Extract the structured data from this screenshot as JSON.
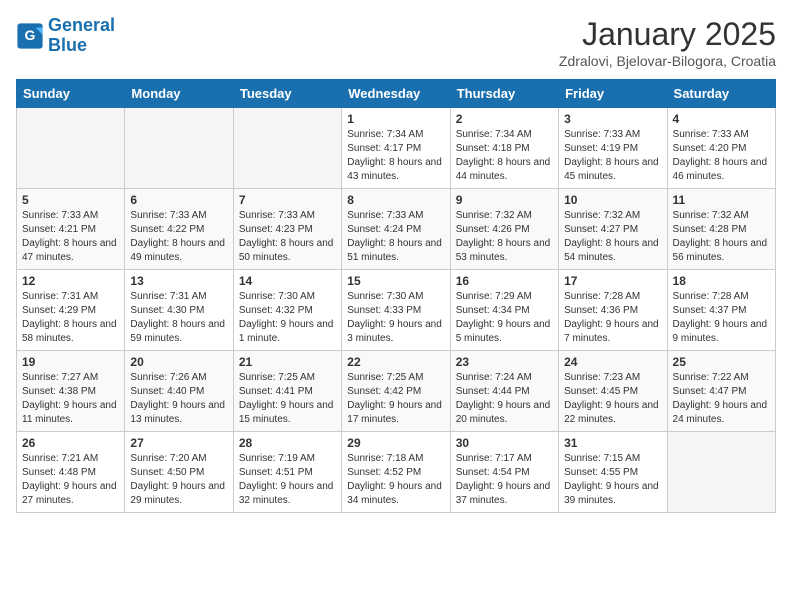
{
  "logo": {
    "line1": "General",
    "line2": "Blue"
  },
  "title": "January 2025",
  "subtitle": "Zdralovi, Bjelovar-Bilogora, Croatia",
  "weekdays": [
    "Sunday",
    "Monday",
    "Tuesday",
    "Wednesday",
    "Thursday",
    "Friday",
    "Saturday"
  ],
  "weeks": [
    [
      {
        "day": "",
        "info": ""
      },
      {
        "day": "",
        "info": ""
      },
      {
        "day": "",
        "info": ""
      },
      {
        "day": "1",
        "info": "Sunrise: 7:34 AM\nSunset: 4:17 PM\nDaylight: 8 hours and 43 minutes."
      },
      {
        "day": "2",
        "info": "Sunrise: 7:34 AM\nSunset: 4:18 PM\nDaylight: 8 hours and 44 minutes."
      },
      {
        "day": "3",
        "info": "Sunrise: 7:33 AM\nSunset: 4:19 PM\nDaylight: 8 hours and 45 minutes."
      },
      {
        "day": "4",
        "info": "Sunrise: 7:33 AM\nSunset: 4:20 PM\nDaylight: 8 hours and 46 minutes."
      }
    ],
    [
      {
        "day": "5",
        "info": "Sunrise: 7:33 AM\nSunset: 4:21 PM\nDaylight: 8 hours and 47 minutes."
      },
      {
        "day": "6",
        "info": "Sunrise: 7:33 AM\nSunset: 4:22 PM\nDaylight: 8 hours and 49 minutes."
      },
      {
        "day": "7",
        "info": "Sunrise: 7:33 AM\nSunset: 4:23 PM\nDaylight: 8 hours and 50 minutes."
      },
      {
        "day": "8",
        "info": "Sunrise: 7:33 AM\nSunset: 4:24 PM\nDaylight: 8 hours and 51 minutes."
      },
      {
        "day": "9",
        "info": "Sunrise: 7:32 AM\nSunset: 4:26 PM\nDaylight: 8 hours and 53 minutes."
      },
      {
        "day": "10",
        "info": "Sunrise: 7:32 AM\nSunset: 4:27 PM\nDaylight: 8 hours and 54 minutes."
      },
      {
        "day": "11",
        "info": "Sunrise: 7:32 AM\nSunset: 4:28 PM\nDaylight: 8 hours and 56 minutes."
      }
    ],
    [
      {
        "day": "12",
        "info": "Sunrise: 7:31 AM\nSunset: 4:29 PM\nDaylight: 8 hours and 58 minutes."
      },
      {
        "day": "13",
        "info": "Sunrise: 7:31 AM\nSunset: 4:30 PM\nDaylight: 8 hours and 59 minutes."
      },
      {
        "day": "14",
        "info": "Sunrise: 7:30 AM\nSunset: 4:32 PM\nDaylight: 9 hours and 1 minute."
      },
      {
        "day": "15",
        "info": "Sunrise: 7:30 AM\nSunset: 4:33 PM\nDaylight: 9 hours and 3 minutes."
      },
      {
        "day": "16",
        "info": "Sunrise: 7:29 AM\nSunset: 4:34 PM\nDaylight: 9 hours and 5 minutes."
      },
      {
        "day": "17",
        "info": "Sunrise: 7:28 AM\nSunset: 4:36 PM\nDaylight: 9 hours and 7 minutes."
      },
      {
        "day": "18",
        "info": "Sunrise: 7:28 AM\nSunset: 4:37 PM\nDaylight: 9 hours and 9 minutes."
      }
    ],
    [
      {
        "day": "19",
        "info": "Sunrise: 7:27 AM\nSunset: 4:38 PM\nDaylight: 9 hours and 11 minutes."
      },
      {
        "day": "20",
        "info": "Sunrise: 7:26 AM\nSunset: 4:40 PM\nDaylight: 9 hours and 13 minutes."
      },
      {
        "day": "21",
        "info": "Sunrise: 7:25 AM\nSunset: 4:41 PM\nDaylight: 9 hours and 15 minutes."
      },
      {
        "day": "22",
        "info": "Sunrise: 7:25 AM\nSunset: 4:42 PM\nDaylight: 9 hours and 17 minutes."
      },
      {
        "day": "23",
        "info": "Sunrise: 7:24 AM\nSunset: 4:44 PM\nDaylight: 9 hours and 20 minutes."
      },
      {
        "day": "24",
        "info": "Sunrise: 7:23 AM\nSunset: 4:45 PM\nDaylight: 9 hours and 22 minutes."
      },
      {
        "day": "25",
        "info": "Sunrise: 7:22 AM\nSunset: 4:47 PM\nDaylight: 9 hours and 24 minutes."
      }
    ],
    [
      {
        "day": "26",
        "info": "Sunrise: 7:21 AM\nSunset: 4:48 PM\nDaylight: 9 hours and 27 minutes."
      },
      {
        "day": "27",
        "info": "Sunrise: 7:20 AM\nSunset: 4:50 PM\nDaylight: 9 hours and 29 minutes."
      },
      {
        "day": "28",
        "info": "Sunrise: 7:19 AM\nSunset: 4:51 PM\nDaylight: 9 hours and 32 minutes."
      },
      {
        "day": "29",
        "info": "Sunrise: 7:18 AM\nSunset: 4:52 PM\nDaylight: 9 hours and 34 minutes."
      },
      {
        "day": "30",
        "info": "Sunrise: 7:17 AM\nSunset: 4:54 PM\nDaylight: 9 hours and 37 minutes."
      },
      {
        "day": "31",
        "info": "Sunrise: 7:15 AM\nSunset: 4:55 PM\nDaylight: 9 hours and 39 minutes."
      },
      {
        "day": "",
        "info": ""
      }
    ]
  ]
}
